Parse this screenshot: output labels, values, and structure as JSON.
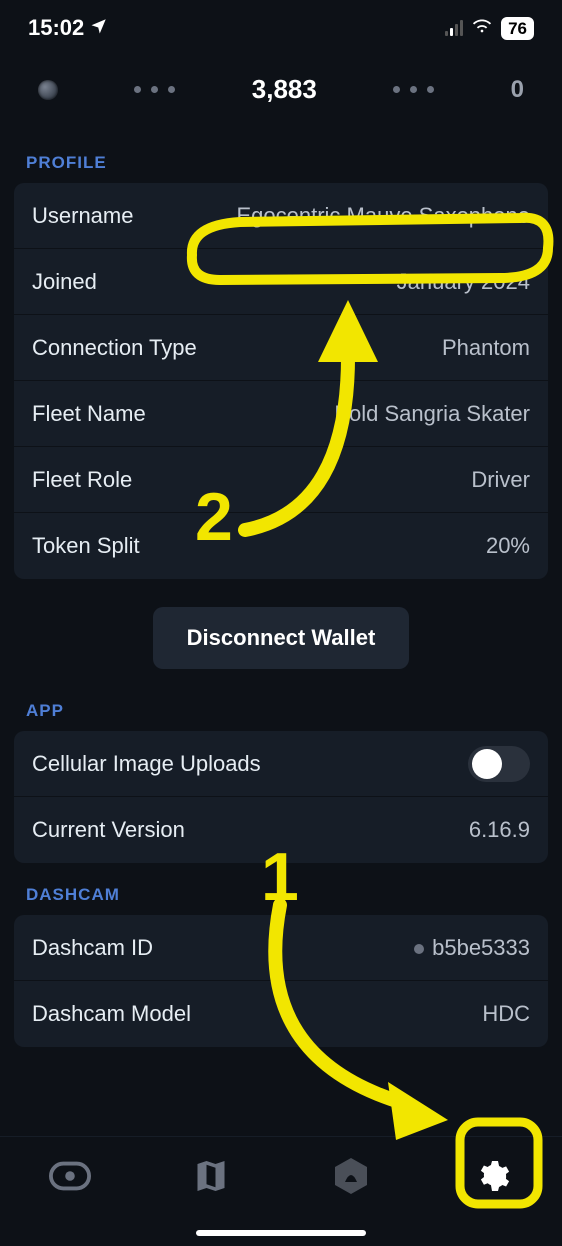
{
  "status_bar": {
    "time": "15:02",
    "battery": "76"
  },
  "stats": {
    "center": "3,883",
    "right": "0"
  },
  "profile": {
    "header": "PROFILE",
    "username_label": "Username",
    "username_value": "Egocentric Mauve Saxophone",
    "joined_label": "Joined",
    "joined_value": "January 2024",
    "connection_type_label": "Connection Type",
    "connection_type_value": "Phantom",
    "fleet_name_label": "Fleet Name",
    "fleet_name_value": "Bold Sangria Skater",
    "fleet_role_label": "Fleet Role",
    "fleet_role_value": "Driver",
    "token_split_label": "Token Split",
    "token_split_value": "20%"
  },
  "disconnect_label": "Disconnect Wallet",
  "app": {
    "header": "APP",
    "cellular_uploads_label": "Cellular Image Uploads",
    "cellular_uploads_on": false,
    "current_version_label": "Current Version",
    "current_version_value": "6.16.9"
  },
  "dashcam": {
    "header": "DASHCAM",
    "id_label": "Dashcam ID",
    "id_value": "b5be5333",
    "model_label": "Dashcam Model",
    "model_value": "HDC"
  },
  "annotations": {
    "number_1": "1",
    "number_2": "2"
  }
}
